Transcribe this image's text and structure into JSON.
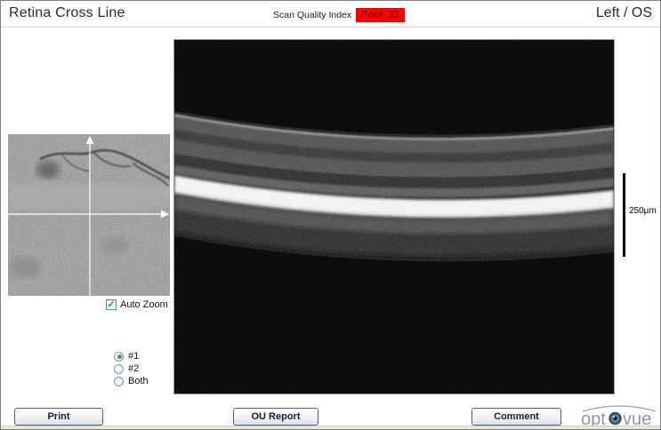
{
  "window": {
    "title": "Retina Cross Line",
    "eye_label": "Left / OS"
  },
  "scan_quality": {
    "label": "Scan Quality Index",
    "value": "Poor  32",
    "badge_bg": "#ff0000",
    "badge_text_color": "#8b0000"
  },
  "fundus": {
    "auto_zoom_label": "Auto Zoom",
    "auto_zoom_checked": true,
    "check_glyph": "✓"
  },
  "scan_select": {
    "options": [
      {
        "label": "#1",
        "selected": true
      },
      {
        "label": "#2",
        "selected": false
      },
      {
        "label": "Both",
        "selected": false
      }
    ]
  },
  "oct": {
    "scale_label": "250µm"
  },
  "buttons": {
    "print": "Print",
    "ou_report": "OU Report",
    "comment": "Comment"
  },
  "logo": {
    "left": "opt",
    "right": "vue"
  }
}
